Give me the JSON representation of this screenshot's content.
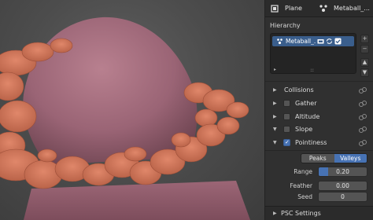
{
  "header": {
    "object_name": "Plane",
    "object_icon": "plane-object-icon",
    "metaball_name": "Metaball_...",
    "metaball_icon": "metaball-icon"
  },
  "hierarchy": {
    "title": "Hierarchy",
    "items": [
      {
        "label": "Metaball_...",
        "icons": [
          "camera-icon",
          "refresh-icon",
          "checkbox-icon"
        ]
      }
    ],
    "side_buttons": [
      "+",
      "−",
      "▲",
      "▼"
    ]
  },
  "sub_panels": [
    {
      "name": "Collisions",
      "expanded": false,
      "has_checkbox": false
    },
    {
      "name": "Gather",
      "expanded": false,
      "has_checkbox": true,
      "checked": false
    },
    {
      "name": "Altitude",
      "expanded": false,
      "has_checkbox": true,
      "checked": false
    },
    {
      "name": "Slope",
      "expanded": true,
      "has_checkbox": true,
      "checked": false
    },
    {
      "name": "Pointiness",
      "expanded": true,
      "has_checkbox": true,
      "checked": true
    }
  ],
  "pointiness": {
    "mode_options": [
      "Peaks",
      "Valleys"
    ],
    "mode_selected": "Valleys",
    "range_label": "Range",
    "range_value": "0.20",
    "range_fraction": 0.2,
    "feather_label": "Feather",
    "feather_value": "0.00",
    "seed_label": "Seed",
    "seed_value": "0"
  },
  "footer": {
    "name": "PSC Settings"
  },
  "colors": {
    "accent": "#4772b3",
    "mound": "#a87080",
    "foam": "#d07858"
  }
}
